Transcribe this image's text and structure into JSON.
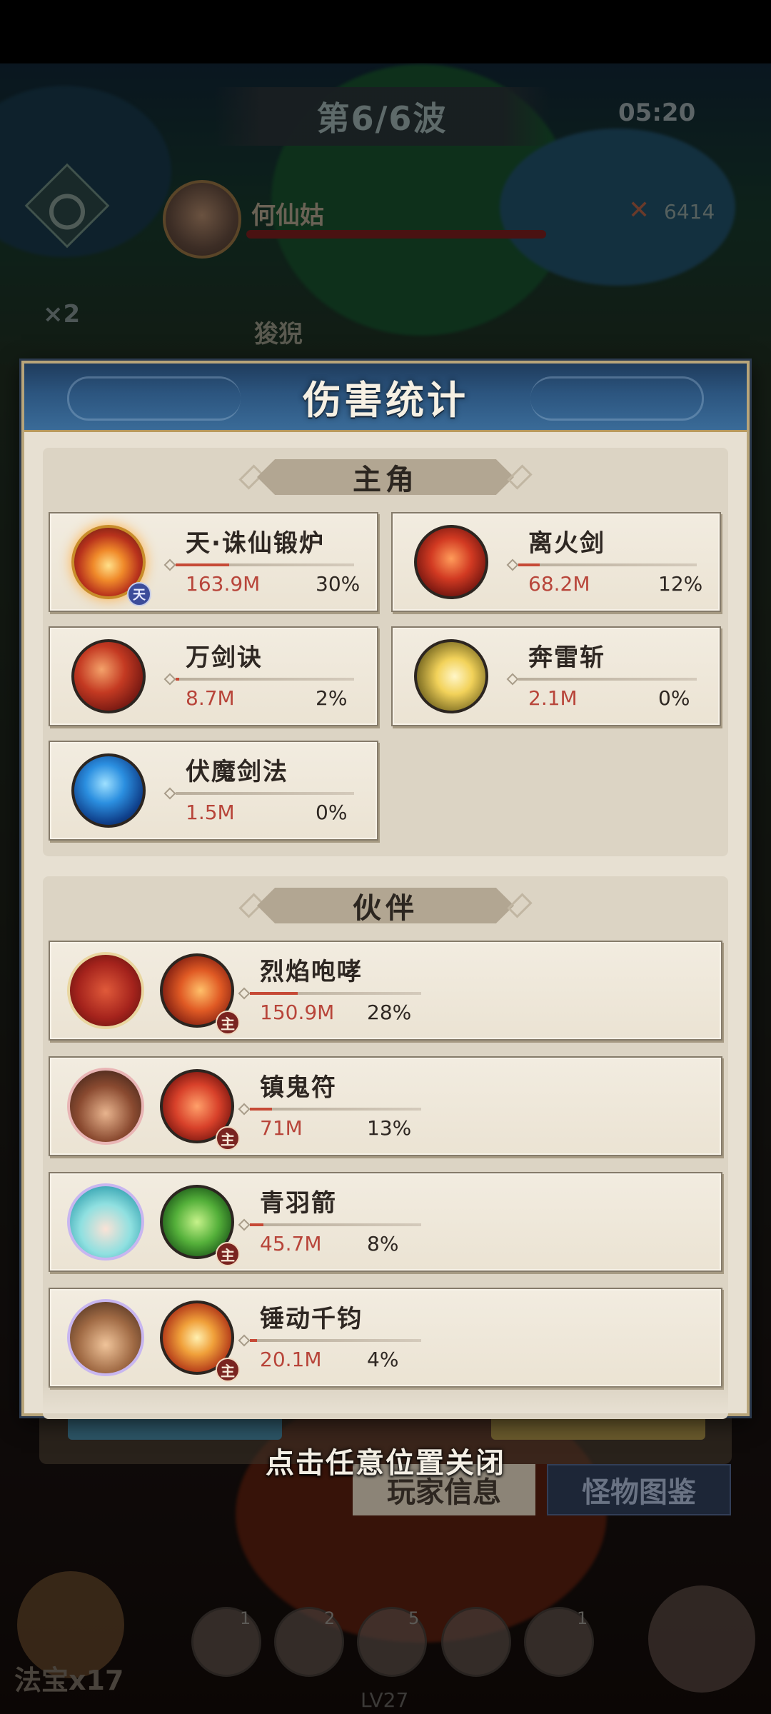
{
  "hud": {
    "wave": "第6/6波",
    "timer": "05:20",
    "speed": "×2",
    "boss_name": "何仙姑",
    "boss_power": "6414",
    "boss2_name": "狻猊"
  },
  "panel": {
    "title": "伤害统计",
    "protagonist": {
      "heading": "主角",
      "skills": [
        {
          "name": "天·诛仙锻炉",
          "damage": "163.9M",
          "percent": "30%",
          "share": 0.3,
          "icon": "flame-forge-icon",
          "badge": "天"
        },
        {
          "name": "离火剑",
          "damage": "68.2M",
          "percent": "12%",
          "share": 0.12,
          "icon": "fire-sword-icon"
        },
        {
          "name": "万剑诀",
          "damage": "8.7M",
          "percent": "2%",
          "share": 0.02,
          "icon": "sword-rain-icon"
        },
        {
          "name": "奔雷斩",
          "damage": "2.1M",
          "percent": "0%",
          "share": 0.0,
          "icon": "thunder-slash-icon"
        },
        {
          "name": "伏魔剑法",
          "damage": "1.5M",
          "percent": "0%",
          "share": 0.0,
          "icon": "demon-sword-icon"
        }
      ]
    },
    "partners": {
      "heading": "伙伴",
      "items": [
        {
          "skill": "烈焰咆哮",
          "damage": "150.9M",
          "percent": "28%",
          "share": 0.28,
          "avatar": "fire-lion-avatar",
          "icon": "flame-roar-icon",
          "badge": "主"
        },
        {
          "skill": "镇鬼符",
          "damage": "71M",
          "percent": "13%",
          "share": 0.13,
          "avatar": "bearded-general-avatar",
          "icon": "talisman-icon",
          "badge": "主"
        },
        {
          "skill": "青羽箭",
          "damage": "45.7M",
          "percent": "8%",
          "share": 0.08,
          "avatar": "teal-hair-girl-avatar",
          "icon": "feather-arrow-icon",
          "badge": "主"
        },
        {
          "skill": "锤动千钧",
          "damage": "20.1M",
          "percent": "4%",
          "share": 0.04,
          "avatar": "warrior-avatar",
          "icon": "hammer-burst-icon",
          "badge": "主"
        }
      ]
    }
  },
  "footer": {
    "close_hint": "点击任意位置关闭",
    "player_info": "玩家信息",
    "monster_guide": "怪物图鉴",
    "fabao": "法宝x17",
    "level": "LV27",
    "slot_counts": [
      "1",
      "2",
      "5",
      "1"
    ]
  },
  "colors": {
    "panel_bg": "#e7e0d2",
    "header_blue": "#2c557f",
    "damage_red": "#b8453a",
    "card_border": "#857b6a"
  }
}
